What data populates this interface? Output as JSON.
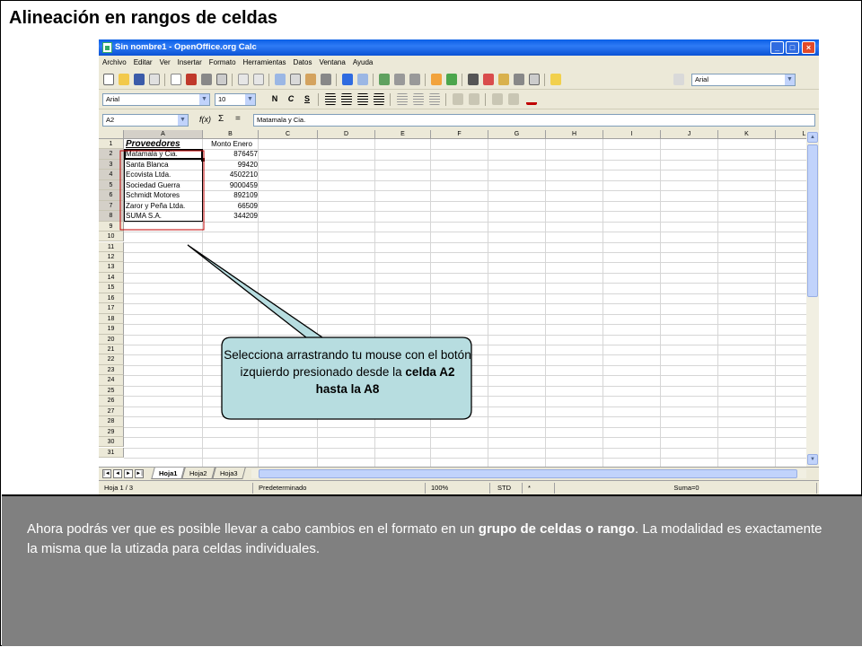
{
  "slide": {
    "title": "Alineación en rangos de celdas",
    "caption_pre": "Ahora podrás ver que es posible llevar a cabo cambios en el formato en un ",
    "caption_bold": "grupo de celdas o rango",
    "caption_post": ". La modalidad es exactamente la misma que la utizada para celdas individuales.",
    "callout_pre": "Selecciona arrastrando tu mouse con el botón izquierdo presionado desde la ",
    "callout_bold": "celda A2 hasta la A8"
  },
  "window": {
    "title": "Sin nombre1 - OpenOffice.org Calc",
    "min": "_",
    "max": "□",
    "close": "×"
  },
  "menu": [
    "Archivo",
    "Editar",
    "Ver",
    "Insertar",
    "Formato",
    "Herramientas",
    "Datos",
    "Ventana",
    "Ayuda"
  ],
  "toolbar": {
    "font_combo_top": "Arial",
    "font_name": "Arial",
    "font_size": "10",
    "bold": "N",
    "italic": "C",
    "underline": "S"
  },
  "formula": {
    "name_box": "A2",
    "fx": "f(x)",
    "sigma": "Σ",
    "equals": "=",
    "content": "Matamala y Cia."
  },
  "sheet": {
    "columns": [
      "A",
      "B",
      "C",
      "D",
      "E",
      "F",
      "G",
      "H",
      "I",
      "J",
      "K",
      "L"
    ],
    "rows": [
      "1",
      "2",
      "3",
      "4",
      "5",
      "6",
      "7",
      "8",
      "9",
      "10",
      "11",
      "12",
      "13",
      "14",
      "15",
      "16",
      "17",
      "18",
      "19",
      "20",
      "21",
      "22",
      "23",
      "24",
      "25",
      "26",
      "27",
      "28",
      "29",
      "30",
      "31"
    ],
    "header_a": "Proveedores",
    "header_b": "Monto Enero",
    "data": [
      {
        "name": "Matamala y Cia.",
        "amount": "876457"
      },
      {
        "name": "Santa Blanca",
        "amount": "99420"
      },
      {
        "name": "Ecovista Ltda.",
        "amount": "4502210"
      },
      {
        "name": "Sociedad Guerra",
        "amount": "9000459"
      },
      {
        "name": "Schmidt Motores",
        "amount": "892109"
      },
      {
        "name": "Zaror y Peña Ltda.",
        "amount": "66509"
      },
      {
        "name": "SUMA S.A.",
        "amount": "344209"
      }
    ]
  },
  "tabs": [
    "Hoja1",
    "Hoja2",
    "Hoja3"
  ],
  "status": {
    "sheet": "Hoja 1 / 3",
    "style": "Predeterminado",
    "zoom": "100%",
    "mode": "STD",
    "modified": "*",
    "sum": "Suma=0"
  },
  "colors": {
    "bottom_panel": "#808080",
    "callout_fill": "#B7DDE0",
    "selection_border": "#C00000",
    "titlebar": "#0A5FE6"
  }
}
